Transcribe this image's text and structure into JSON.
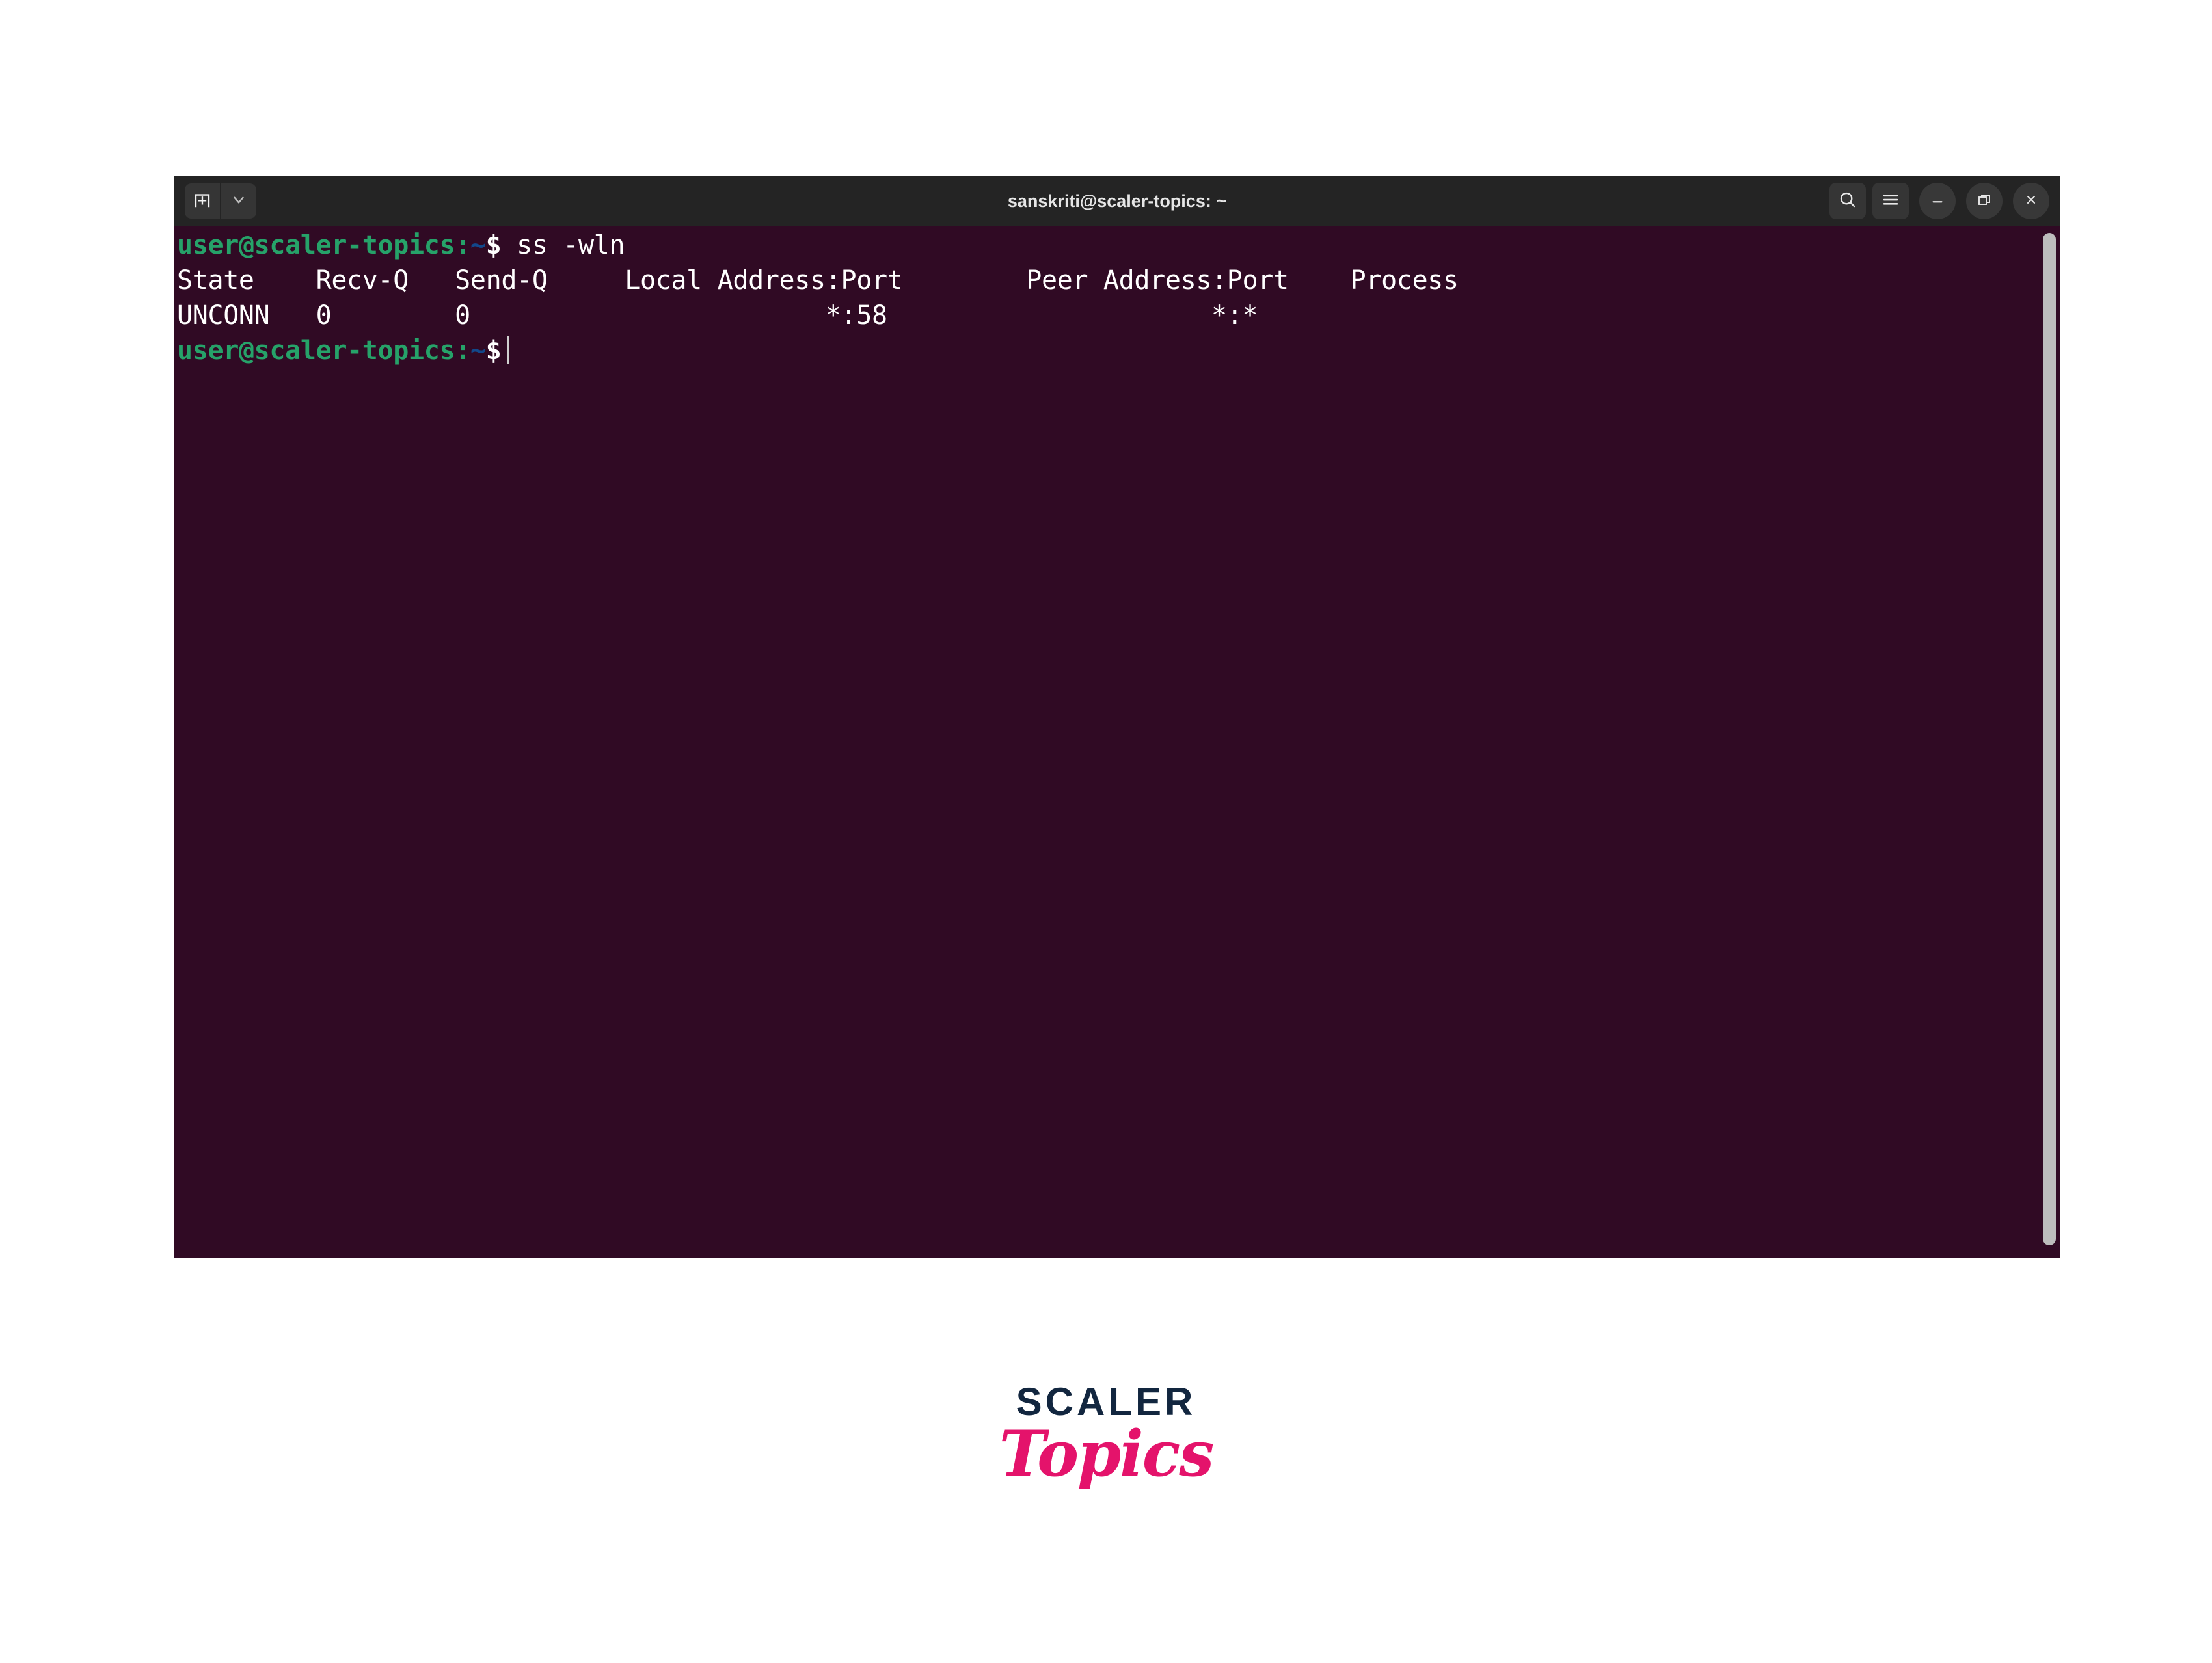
{
  "window": {
    "title": "sanskriti@scaler-topics: ~",
    "titlebar_bg": "#242424",
    "terminal_bg": "#300a24",
    "prompt_color": "#26a269",
    "tilde_color": "#12488b"
  },
  "titlebar": {
    "new_tab_label": "new-tab-icon",
    "dropdown_label": "chevron-down-icon",
    "search_label": "search-icon",
    "menu_label": "hamburger-menu-icon",
    "minimize_label": "minimize-icon",
    "maximize_label": "maximize-icon",
    "close_label": "close-icon"
  },
  "terminal": {
    "line1": {
      "user_host": "user@scaler-topics",
      "colon": ":",
      "tilde": "~",
      "dollar": "$",
      "command": " ss -wln"
    },
    "headers_line": "State    Recv-Q   Send-Q     Local Address:Port        Peer Address:Port    Process",
    "row_line": "UNCONN   0        0                       *:58                     *:*          ",
    "line4": {
      "user_host": "user@scaler-topics",
      "colon": ":",
      "tilde": "~",
      "dollar": "$"
    },
    "columns": [
      "State",
      "Recv-Q",
      "Send-Q",
      "Local Address:Port",
      "Peer Address:Port",
      "Process"
    ],
    "rows": [
      {
        "state": "UNCONN",
        "recv_q": "0",
        "send_q": "0",
        "local_address_port": "*:58",
        "peer_address_port": "*:*",
        "process": ""
      }
    ],
    "command_run": "ss -wln"
  },
  "branding": {
    "scaler": "SCALER",
    "topics": "Topics",
    "scaler_color": "#12263f",
    "topics_color": "#e4136b"
  }
}
